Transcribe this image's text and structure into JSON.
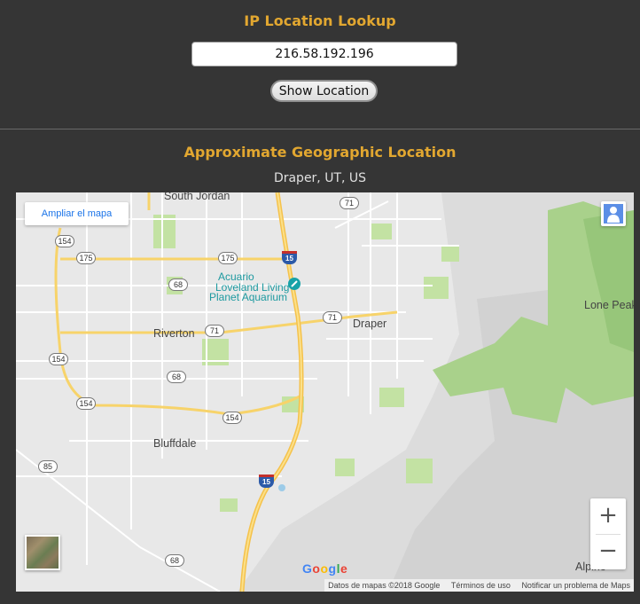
{
  "header": {
    "title": "IP Location Lookup",
    "ip_value": "216.58.192.196",
    "show_button": "Show Location"
  },
  "result": {
    "title": "Approximate Geographic Location",
    "place": "Draper, UT, US"
  },
  "map": {
    "enlarge_link": "Ampliar el mapa",
    "labels": {
      "south_jordan": "South Jordan",
      "riverton": "Riverton",
      "draper": "Draper",
      "bluffdale": "Bluffdale",
      "lone_peak": "Lone Peak",
      "alpine": "Alpine",
      "aquarium_1": "Acuario",
      "aquarium_2": "Loveland Living",
      "aquarium_3": "Planet Aquarium"
    },
    "route_shields": {
      "r154a": "154",
      "r175a": "175",
      "r175b": "175",
      "r68a": "68",
      "r71a": "71",
      "r71b": "71",
      "r71c": "71",
      "r154b": "154",
      "r68b": "68",
      "r154c": "154",
      "r154d": "154",
      "r85": "85",
      "r68c": "68",
      "i15a": "15",
      "i15b": "15"
    },
    "zoom_in": "+",
    "zoom_out": "−",
    "logo": "Google",
    "attribution": {
      "data": "Datos de mapas ©2018 Google",
      "terms": "Términos de uso",
      "report": "Notificar un problema de Maps"
    }
  },
  "colors": {
    "accent": "#e2a730",
    "background": "#353535",
    "map_bg": "#e8e8e8",
    "park": "#c3e2a3",
    "highway": "#f7d36a"
  }
}
